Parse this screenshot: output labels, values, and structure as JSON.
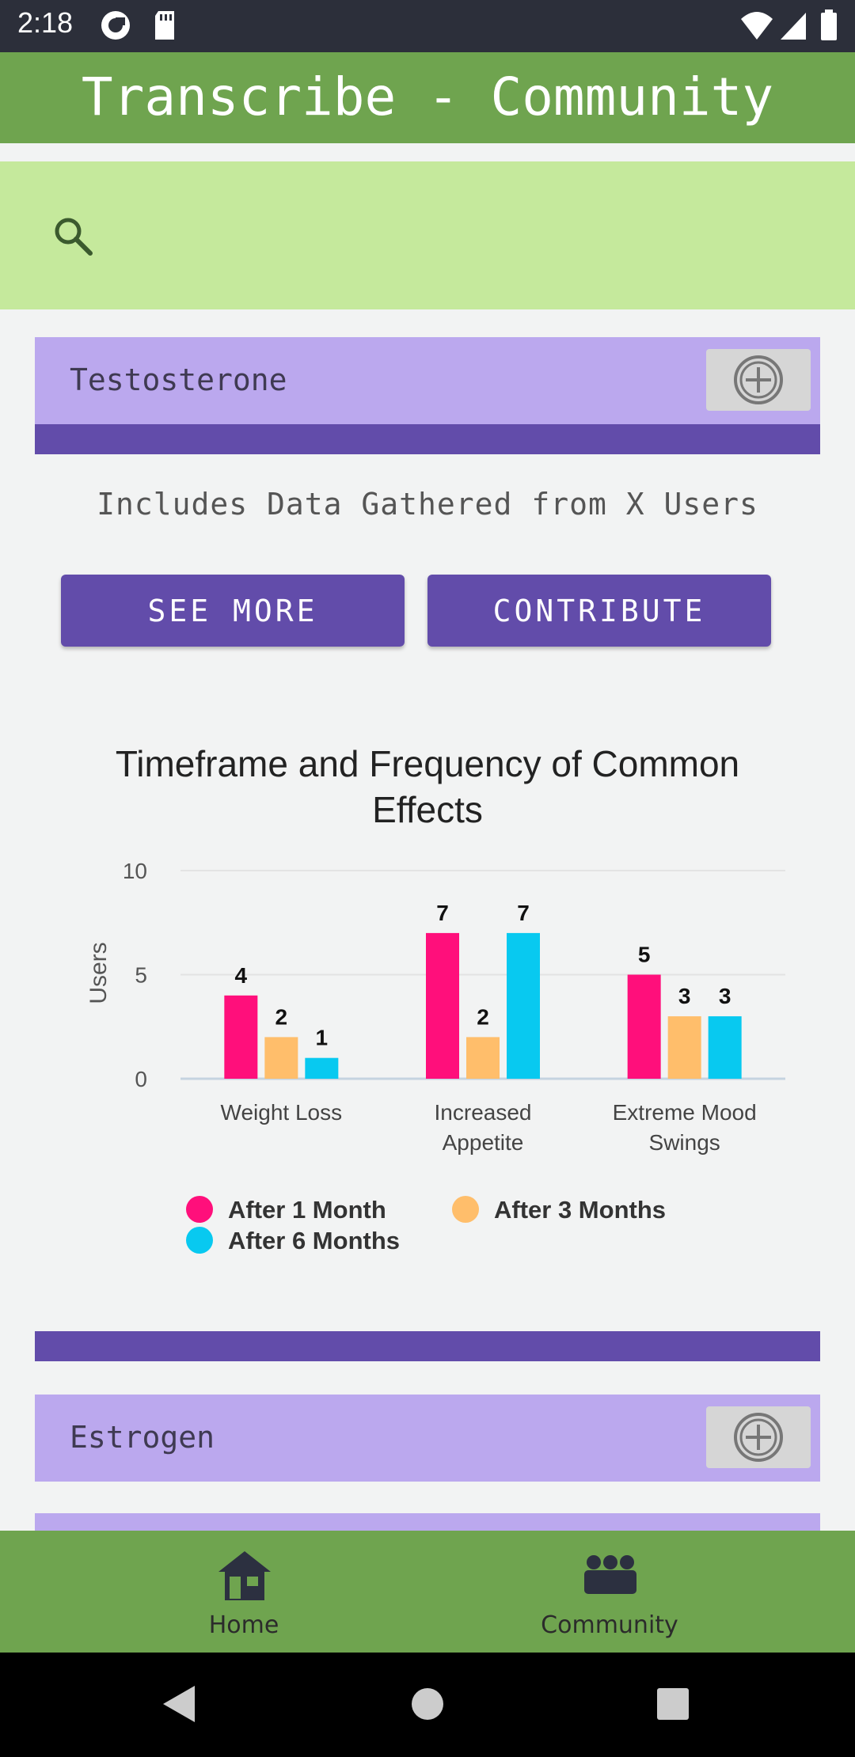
{
  "status_bar": {
    "time": "2:18",
    "left_icons": [
      "pocket-casts-icon",
      "sd-card-icon"
    ],
    "right_icons": [
      "wifi-icon",
      "signal-icon",
      "battery-icon"
    ]
  },
  "app_bar": {
    "title": "Transcribe - Community"
  },
  "search": {
    "icon": "search-icon",
    "placeholder": ""
  },
  "sections": [
    {
      "title": "Testosterone",
      "users_note": "Includes Data Gathered from X Users",
      "see_more_label": "SEE MORE",
      "contribute_label": "CONTRIBUTE"
    },
    {
      "title": "Estrogen"
    }
  ],
  "chart_data": {
    "type": "bar",
    "title": "Timeframe and Frequency of Common Effects",
    "ylabel": "Users",
    "xlabel": "",
    "ylim": [
      0,
      10
    ],
    "yticks": [
      0,
      5,
      10
    ],
    "categories": [
      "Weight Loss",
      "Increased Appetite",
      "Extreme Mood Swings"
    ],
    "category_lines": [
      [
        "Weight Loss"
      ],
      [
        "Increased",
        "Appetite"
      ],
      [
        "Extreme Mood",
        "Swings"
      ]
    ],
    "series": [
      {
        "name": "After 1 Month",
        "color": "#ff0f7b",
        "values": [
          4,
          7,
          5
        ]
      },
      {
        "name": "After 3 Months",
        "color": "#ffbe6b",
        "values": [
          2,
          2,
          3
        ]
      },
      {
        "name": "After 6 Months",
        "color": "#08c9f0",
        "values": [
          1,
          7,
          3
        ]
      }
    ],
    "grid": true,
    "legend_position": "bottom"
  },
  "bottom_nav": {
    "items": [
      {
        "label": "Home",
        "icon": "home-icon"
      },
      {
        "label": "Community",
        "icon": "community-icon"
      }
    ]
  },
  "system_nav": {
    "icons": [
      "back-icon",
      "home-circle-icon",
      "recents-icon"
    ]
  },
  "colors": {
    "app_bar": "#6fa44f",
    "search_bar": "#c5e99c",
    "section_header": "#bba8ee",
    "accent_purple": "#624caa",
    "background": "#f2f3f3"
  }
}
